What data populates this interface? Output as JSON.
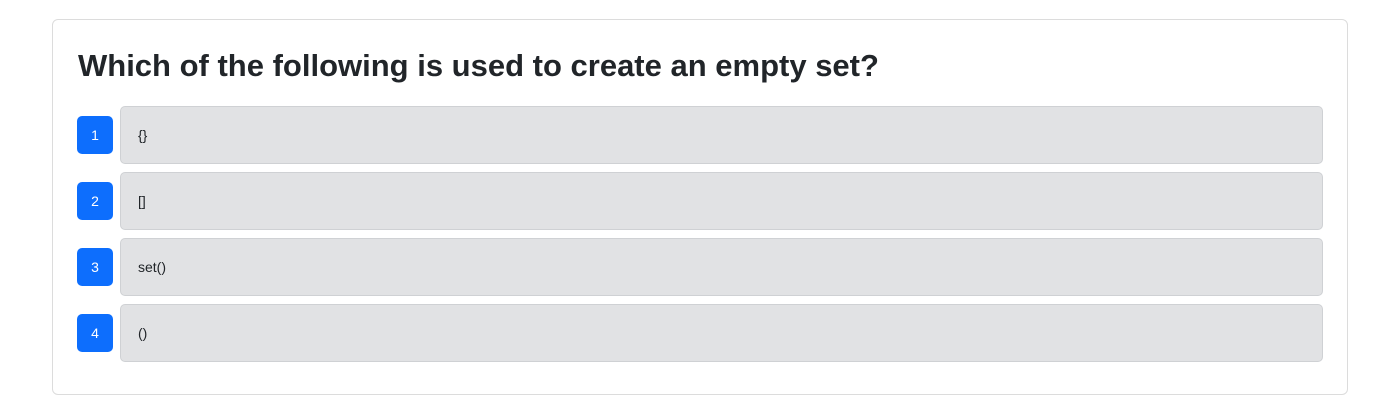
{
  "question": {
    "title": "Which of the following is used to create an empty set?"
  },
  "options": [
    {
      "number": "1",
      "text": "{}"
    },
    {
      "number": "2",
      "text": "[]"
    },
    {
      "number": "3",
      "text": "set()"
    },
    {
      "number": "4",
      "text": "()"
    }
  ],
  "colors": {
    "accent": "#0d6efd",
    "option_background": "#e1e2e4",
    "card_border": "#dcdcdc",
    "text": "#212529"
  }
}
